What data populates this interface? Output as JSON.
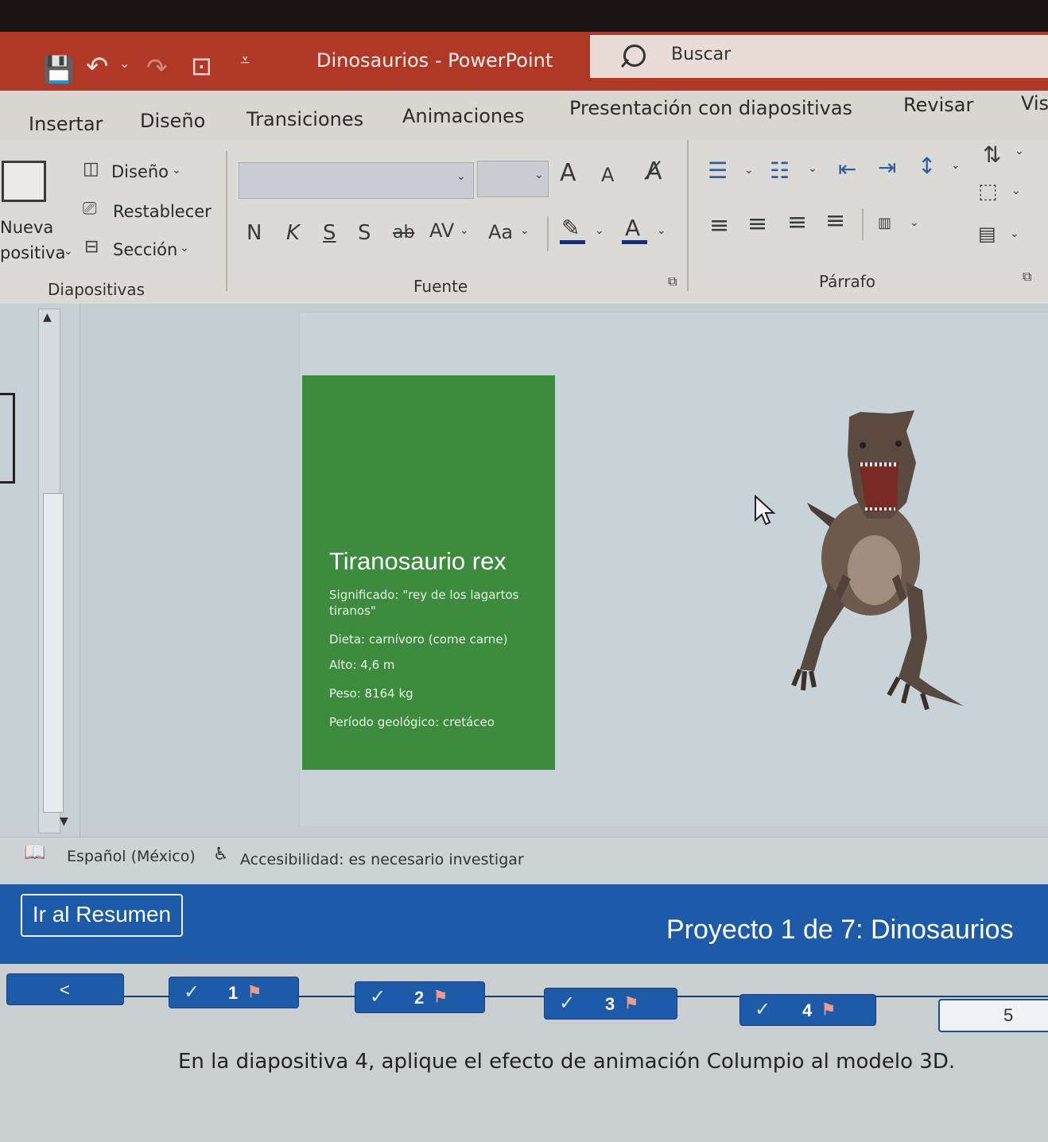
{
  "window": {
    "title": "Dinosaurios - PowerPoint",
    "search_placeholder": "Buscar"
  },
  "tabs": [
    "Insertar",
    "Diseño",
    "Transiciones",
    "Animaciones",
    "Presentación con diapositivas",
    "Revisar",
    "Vis"
  ],
  "ribbon": {
    "slides_group": {
      "new_slide_line1": "Nueva",
      "new_slide_line2": "positiva",
      "layout": "Diseño",
      "reset": "Restablecer",
      "section": "Sección",
      "label": "Diapositivas"
    },
    "font_group": {
      "bold": "N",
      "italic": "K",
      "underline": "S",
      "shadow": "S",
      "strikethrough": "ab",
      "spacing": "AV",
      "case": "Aa",
      "grow": "A",
      "shrink": "A",
      "label": "Fuente"
    },
    "paragraph_group": {
      "label": "Párrafo"
    }
  },
  "slide": {
    "title": "Tiranosaurio rex",
    "lines": [
      "Significado: \"rey de los lagartos tiranos\"",
      "Dieta: carnívoro (come carne)",
      "Alto: 4,6 m",
      "Peso: 8164 kg",
      "Período geológico: cretáceo"
    ],
    "colors": {
      "text_box": "#3d8b3d",
      "canvas": "#c7d3d6"
    },
    "model_3d": "tyrannosaurus-rex-model"
  },
  "statusbar": {
    "language": "Español (México)",
    "accessibility": "Accesibilidad: es necesario investigar"
  },
  "exam": {
    "summary_button": "Ir al Resumen",
    "project_title": "Proyecto 1 de 7: Dinosaurios",
    "prev_button": "<",
    "tasks": [
      {
        "number": "1",
        "done": true,
        "flagged": true
      },
      {
        "number": "2",
        "done": true,
        "flagged": true
      },
      {
        "number": "3",
        "done": true,
        "flagged": true
      },
      {
        "number": "4",
        "done": true,
        "flagged": true
      },
      {
        "number": "5",
        "done": false,
        "flagged": false
      }
    ],
    "instruction": "En la diapositiva 4, aplique el efecto de animación Columpio al modelo 3D.",
    "colors": {
      "banner": "#1d5aa8",
      "title_bar": "#b03826"
    }
  }
}
